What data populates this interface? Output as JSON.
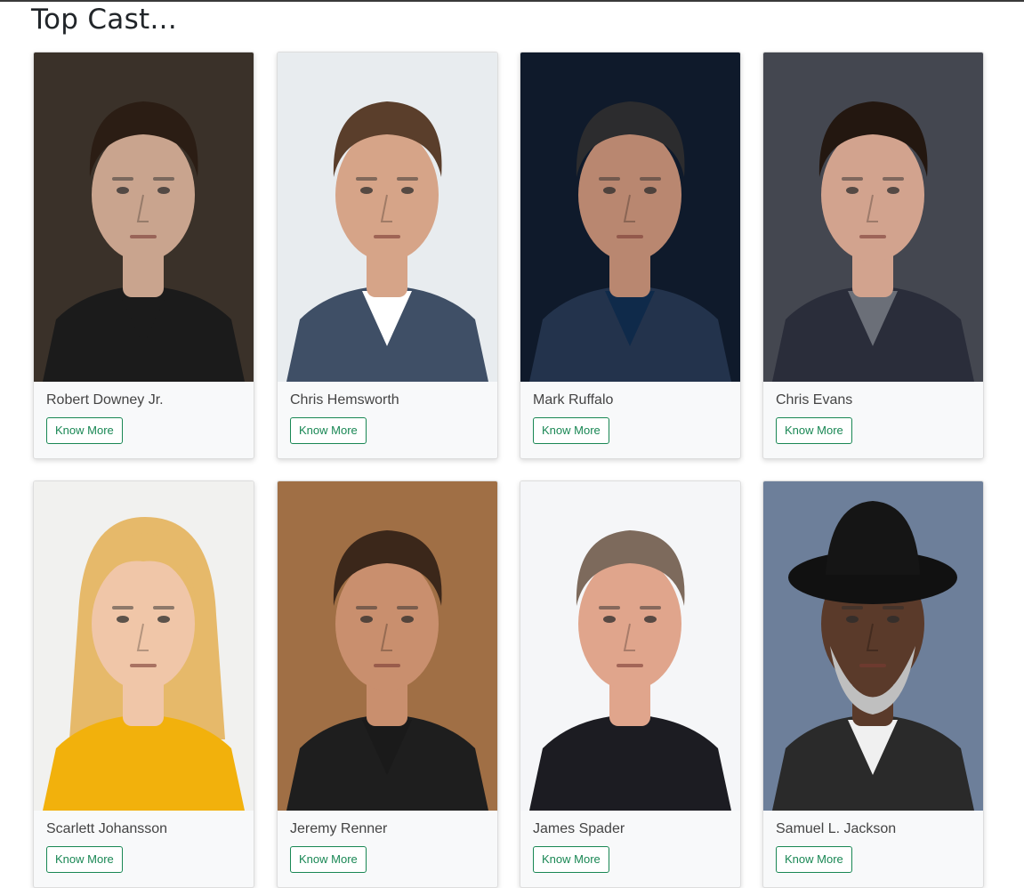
{
  "page": {
    "title": "Top Cast..."
  },
  "cast": [
    {
      "name": "Robert Downey Jr.",
      "button": "Know More",
      "bg": "#3a3129",
      "skin": "#c9a48e",
      "hair": "#2b1d14",
      "cloth": "#1b1b1b",
      "shirt": "#1b1b1b"
    },
    {
      "name": "Chris Hemsworth",
      "button": "Know More",
      "bg": "#e8ecef",
      "skin": "#d6a488",
      "hair": "#5a3e2b",
      "cloth": "#3f4f66",
      "shirt": "#ffffff"
    },
    {
      "name": "Mark Ruffalo",
      "button": "Know More",
      "bg": "#0f1a2b",
      "skin": "#b98770",
      "hair": "#2c2c2e",
      "cloth": "#23334c",
      "shirt": "#0f2a4a"
    },
    {
      "name": "Chris Evans",
      "button": "Know More",
      "bg": "#444750",
      "skin": "#d2a38e",
      "hair": "#231710",
      "cloth": "#2a2d3a",
      "shirt": "#6b6f78"
    },
    {
      "name": "Scarlett Johansson",
      "button": "Know More",
      "bg": "#f1f1ef",
      "skin": "#f0c6a8",
      "hair": "#e6b96a",
      "cloth": "#f2b10c",
      "shirt": "#f2b10c"
    },
    {
      "name": "Jeremy Renner",
      "button": "Know More",
      "bg": "#a06f45",
      "skin": "#c98f6e",
      "hair": "#3b271a",
      "cloth": "#1e1e1e",
      "shirt": "#1a1a1a"
    },
    {
      "name": "James Spader",
      "button": "Know More",
      "bg": "#f5f6f8",
      "skin": "#e0a58c",
      "hair": "#7d6a5c",
      "cloth": "#1c1c22",
      "shirt": "#1c1c22"
    },
    {
      "name": "Samuel L. Jackson",
      "button": "Know More",
      "bg": "#6d7f9a",
      "skin": "#5a3a2a",
      "hair": "#bfbfbf",
      "cloth": "#2a2a2a",
      "shirt": "#f0f0f0"
    }
  ]
}
